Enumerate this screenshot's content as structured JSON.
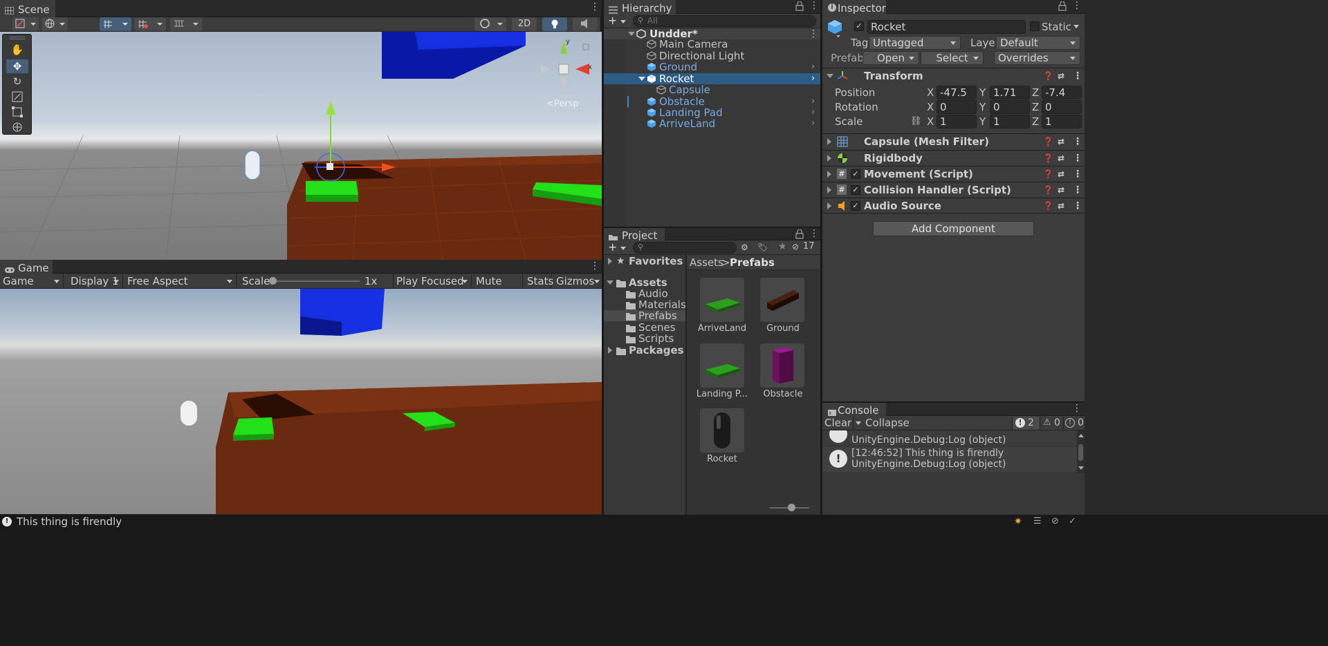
{
  "scene": {
    "tab": "Scene",
    "toolbar": {
      "mode_2d": "2D"
    },
    "gizmo": {
      "persp": "<Persp",
      "axis_y": "y",
      "axis_x": "x"
    }
  },
  "game": {
    "tab": "Game",
    "view_select": "Game",
    "display": "Display 1",
    "aspect": "Free Aspect",
    "scale_label": "Scale",
    "scale_value": "1x",
    "play_mode": "Play Focused",
    "mute": "Mute Audio",
    "stats": "Stats",
    "gizmos": "Gizmos"
  },
  "hierarchy": {
    "tab": "Hierarchy",
    "search_placeholder": "All",
    "scene_name": "Undder*",
    "items": [
      {
        "label": "Main Camera"
      },
      {
        "label": "Directional Light"
      },
      {
        "label": "Ground"
      },
      {
        "label": "Rocket"
      },
      {
        "label": "Capsule"
      },
      {
        "label": "Obstacle"
      },
      {
        "label": "Landing Pad"
      },
      {
        "label": "ArriveLand"
      }
    ]
  },
  "project": {
    "tab": "Project",
    "hidden_count": "17",
    "tree": {
      "favorites": "Favorites",
      "assets": "Assets",
      "folders": [
        "Audio",
        "Materials",
        "Prefabs",
        "Scenes",
        "Scripts"
      ],
      "packages": "Packages"
    },
    "breadcrumb": {
      "root": "Assets",
      "sep": ">",
      "current": "Prefabs"
    },
    "assets": [
      {
        "label": "ArriveLand",
        "color": "#1f6b12"
      },
      {
        "label": "Ground",
        "color": "#3c1a0e"
      },
      {
        "label": "Landing P...",
        "color": "#1f6b12"
      },
      {
        "label": "Obstacle",
        "color": "#6e0f5c"
      },
      {
        "label": "Rocket",
        "color": "#2a2a2a"
      }
    ]
  },
  "inspector": {
    "tab": "Inspector",
    "object_name": "Rocket",
    "static_label": "Static",
    "tag_label": "Tag",
    "tag_value": "Untagged",
    "layer_label": "Layer",
    "layer_value": "Default",
    "prefab_label": "Prefab",
    "open": "Open",
    "select": "Select",
    "overrides": "Overrides",
    "transform": {
      "title": "Transform",
      "position_label": "Position",
      "rotation_label": "Rotation",
      "scale_label": "Scale",
      "x": "X",
      "y": "Y",
      "z": "Z",
      "position": [
        "-47.5",
        "1.71",
        "-7.4"
      ],
      "rotation": [
        "0",
        "0",
        "0"
      ],
      "scale": [
        "1",
        "1",
        "1"
      ]
    },
    "components": [
      {
        "label": "Capsule (Mesh Filter)"
      },
      {
        "label": "Rigidbody"
      },
      {
        "label": "Movement (Script)"
      },
      {
        "label": "Collision Handler (Script)"
      },
      {
        "label": "Audio Source"
      }
    ],
    "add_component": "Add Component"
  },
  "console": {
    "tab": "Console",
    "clear": "Clear",
    "collapse": "Collapse",
    "error_count": "2",
    "warn_count": "0",
    "info_count": "0",
    "entries": [
      {
        "line1": "",
        "line2": "UnityEngine.Debug:Log (object)"
      },
      {
        "line1": "[12:46:52] This thing is firendly",
        "line2": "UnityEngine.Debug:Log (object)"
      }
    ]
  },
  "status_bar": {
    "message": "This thing is firendly"
  },
  "colors": {
    "accent": "#2c5d87",
    "panel": "#383838",
    "sky_top": "#9ab2cc",
    "ground": "#6b2a0f",
    "pad": "#22e01a"
  }
}
